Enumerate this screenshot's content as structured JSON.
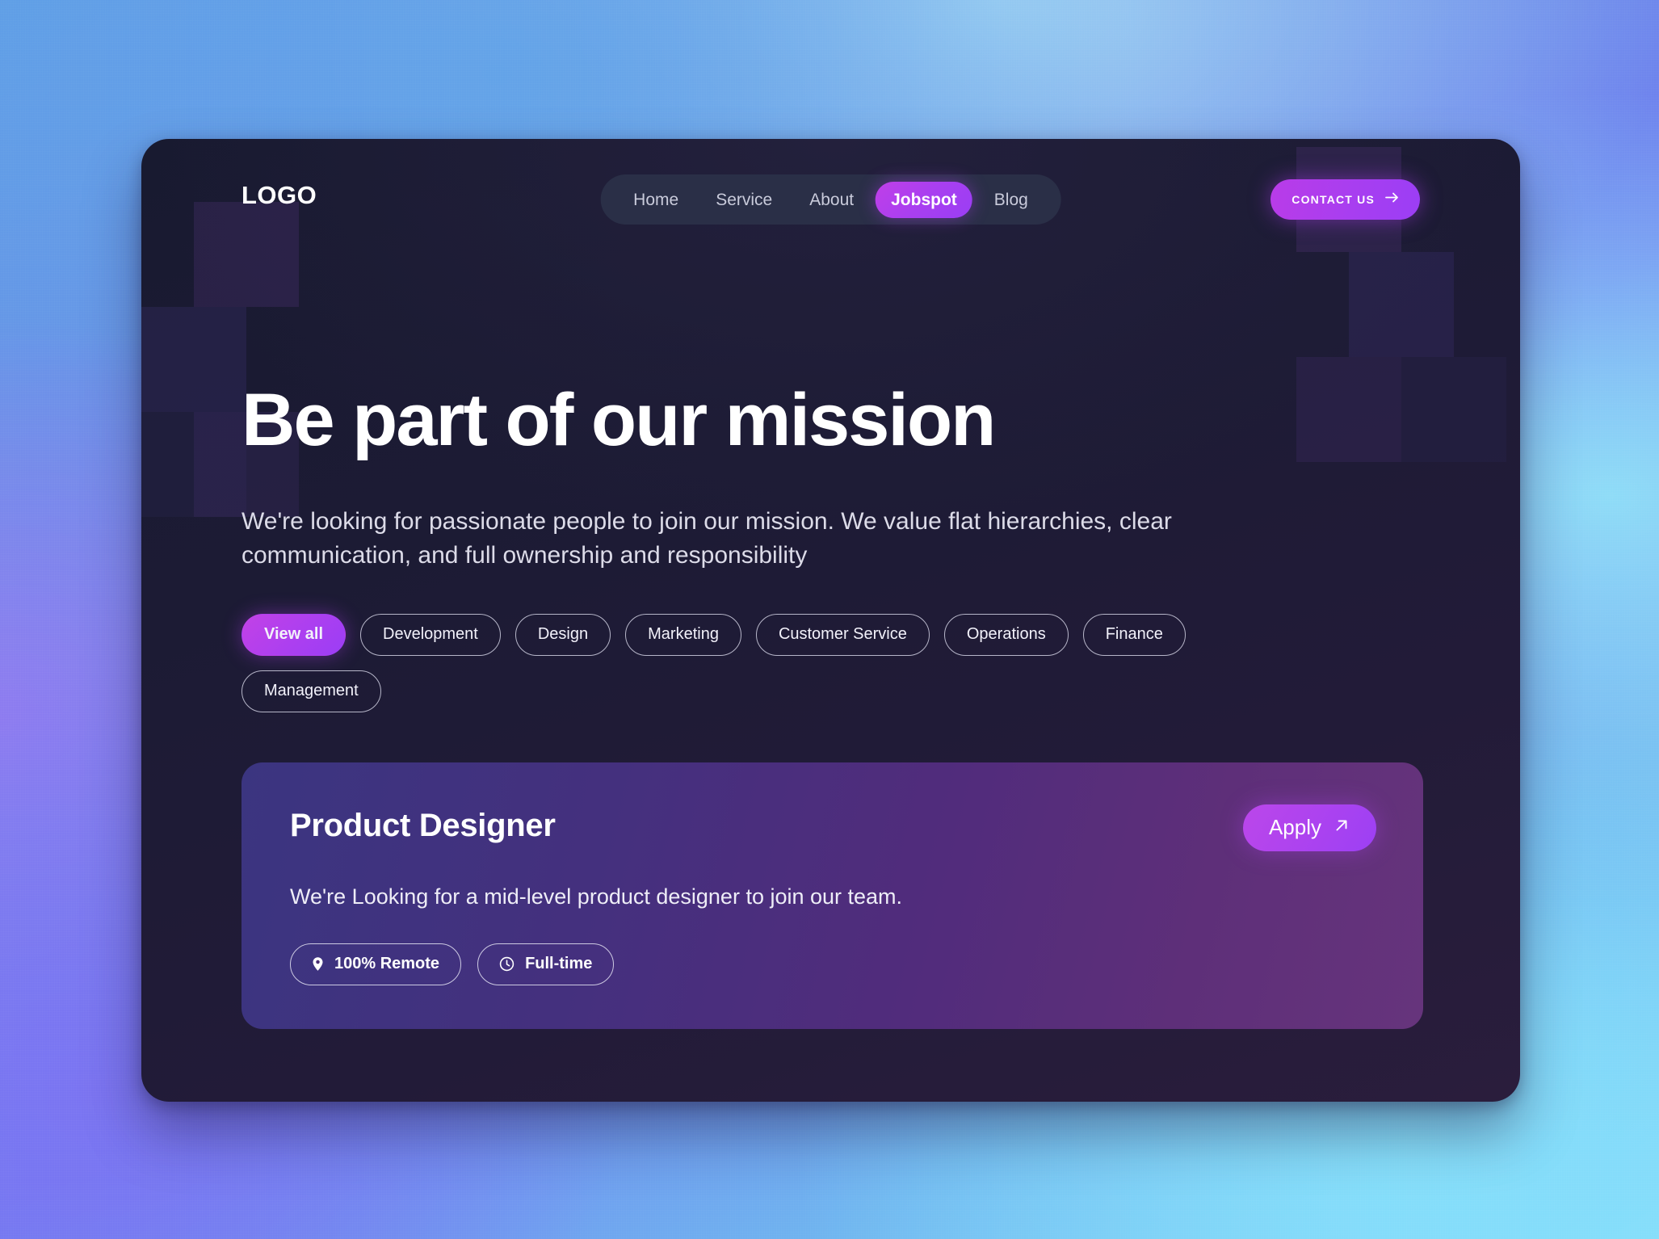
{
  "brand": {
    "logo_text": "LOGO",
    "accent_color": "#a83ef0",
    "accent_color_2": "#c03fe8"
  },
  "nav": {
    "items": [
      {
        "label": "Home",
        "active": false
      },
      {
        "label": "Service",
        "active": false
      },
      {
        "label": "About",
        "active": false
      },
      {
        "label": "Jobspot",
        "active": true
      },
      {
        "label": "Blog",
        "active": false
      }
    ]
  },
  "contact_button": {
    "label": "CONTACT US",
    "icon": "arrow-right-icon"
  },
  "hero": {
    "headline": "Be part of our mission",
    "subheadline": "We're looking for passionate people to join our mission. We value flat hierarchies, clear communication, and full ownership and responsibility"
  },
  "filters": {
    "chips": [
      {
        "label": "View all",
        "active": true
      },
      {
        "label": "Development",
        "active": false
      },
      {
        "label": "Design",
        "active": false
      },
      {
        "label": "Marketing",
        "active": false
      },
      {
        "label": "Customer Service",
        "active": false
      },
      {
        "label": "Operations",
        "active": false
      },
      {
        "label": "Finance",
        "active": false
      },
      {
        "label": "Management",
        "active": false
      }
    ]
  },
  "jobs": [
    {
      "title": "Product Designer",
      "description": "We're Looking for a mid-level product designer to join our team.",
      "apply_label": "Apply",
      "apply_icon": "arrow-up-right-icon",
      "tags": [
        {
          "label": "100% Remote",
          "icon": "location-pin-icon"
        },
        {
          "label": "Full-time",
          "icon": "clock-icon"
        }
      ]
    }
  ]
}
